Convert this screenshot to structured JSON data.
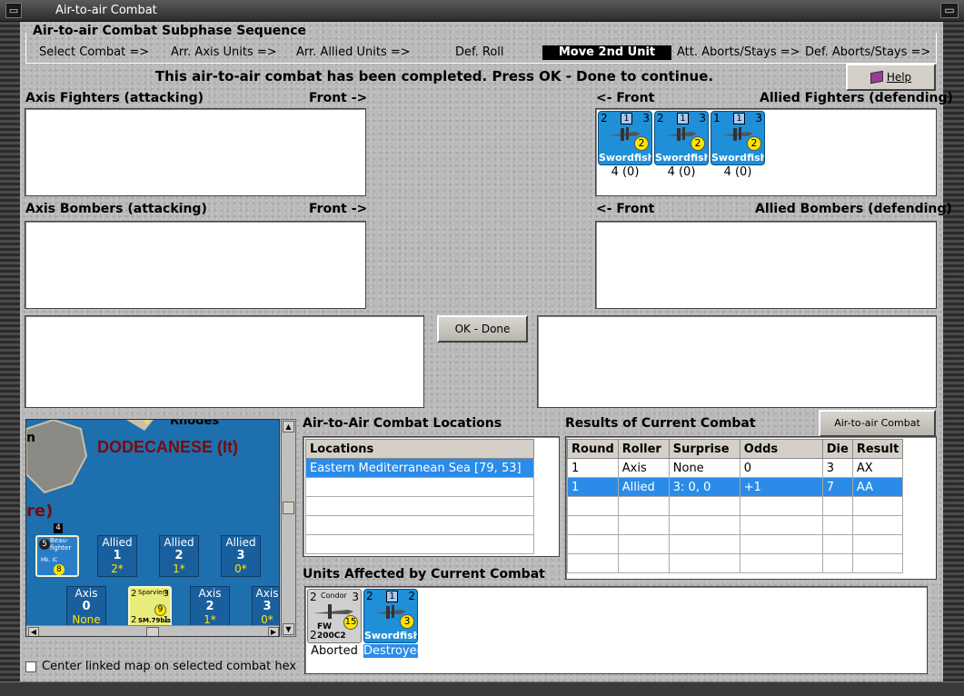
{
  "window": {
    "title": "Air-to-air Combat"
  },
  "phase": {
    "title": "Air-to-air Combat Subphase Sequence",
    "steps": [
      "Select Combat =>",
      "Arr. Axis Units =>",
      "Arr. Allied Units =>",
      "Def. Roll",
      "Move 2nd Unit",
      "Att. Aborts/Stays =>",
      "Def. Aborts/Stays =>"
    ],
    "active_step": "Move 2nd Unit"
  },
  "status_message": "This air-to-air combat has been completed.  Press OK - Done to continue.",
  "help_label": "Help",
  "panels": {
    "axis_fighters": "Axis Fighters (attacking)",
    "axis_fighters_front": "Front ->",
    "allied_fighters_front": "<- Front",
    "allied_fighters": "Allied Fighters (defending)",
    "axis_bombers": "Axis Bombers (attacking)",
    "axis_bombers_front": "Front ->",
    "allied_bombers_front": "<- Front",
    "allied_bombers": "Allied Bombers (defending)"
  },
  "allied_fighter_units": [
    {
      "left": "2",
      "mid": "1",
      "right": "3",
      "token": "2",
      "name": "Swordfish",
      "strength": "4 (0)"
    },
    {
      "left": "2",
      "mid": "1",
      "right": "3",
      "token": "2",
      "name": "Swordfish",
      "strength": "4 (0)"
    },
    {
      "left": "1",
      "mid": "1",
      "right": "3",
      "token": "2",
      "name": "Swordfish",
      "strength": "4 (0)"
    }
  ],
  "ok_button": "OK - Done",
  "map": {
    "region_label": "DODECANESE (It)",
    "top_label": "Rhodes",
    "left_label": "n",
    "left_label2": "re)",
    "hex_num": "4",
    "allied_slots": [
      {
        "title": "Allied",
        "val": "1",
        "sub": "2*"
      },
      {
        "title": "Allied",
        "val": "2",
        "sub": "1*"
      },
      {
        "title": "Allied",
        "val": "3",
        "sub": "0*"
      }
    ],
    "axis_slots": [
      {
        "title": "Axis",
        "val": "0",
        "sub": "None"
      },
      {
        "title": "Axis",
        "val": "2",
        "sub": "1*"
      },
      {
        "title": "Axis",
        "val": "3",
        "sub": "0*"
      }
    ],
    "axis_unit": {
      "name": "Sparviero",
      "type": "SM.79bis",
      "left": "2",
      "right": "3",
      "bottom_left": "2",
      "bottom_right": "1",
      "token": "9"
    },
    "allied_unit": {
      "name": "Beau-fighter",
      "type": "Mk. IC",
      "token": "8",
      "badge": "5"
    }
  },
  "center_linked_label": "Center linked map on selected combat hex",
  "locations": {
    "title": "Air-to-Air Combat Locations",
    "header": "Locations",
    "rows": [
      "Eastern Mediterranean Sea [79, 53]"
    ]
  },
  "results": {
    "title": "Results of Current Combat",
    "chart_button": "Air-to-air Combat Chart",
    "headers": [
      "Round",
      "Roller",
      "Surprise",
      "Odds",
      "Die",
      "Result"
    ],
    "rows": [
      [
        "1",
        "Axis",
        "None",
        "0",
        "3",
        "AX"
      ],
      [
        "1",
        "Allied",
        "3: 0, 0",
        "+1",
        "7",
        "AA"
      ]
    ]
  },
  "affected": {
    "title": "Units Affected by Current Combat",
    "units": [
      {
        "name": "Condor",
        "type": "FW 200C2",
        "left": "2",
        "right": "3",
        "bottom_left": "2",
        "token": "15",
        "status": "Aborted"
      },
      {
        "name": "Swordfish",
        "left": "2",
        "mid": "1",
        "right": "2",
        "token": "3",
        "status": "Destroyed"
      }
    ]
  },
  "colors": {
    "accent_blue": "#2a8ce8",
    "counter_blue": "#1f8fd8",
    "token_yellow": "#ffe600"
  }
}
